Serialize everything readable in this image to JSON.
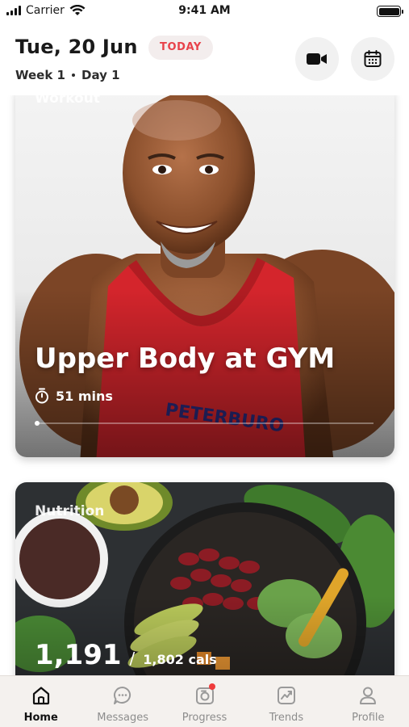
{
  "status_bar": {
    "carrier": "Carrier",
    "time": "9:41 AM"
  },
  "header": {
    "date": "Tue, 20 Jun",
    "today_badge": "TODAY",
    "week": "Week 1",
    "day": "Day 1",
    "video_icon": "video-camera-icon",
    "calendar_icon": "calendar-icon"
  },
  "workout_card": {
    "label": "Workout",
    "title": "Upper Body at GYM",
    "duration": "51 mins",
    "progress_fraction": 0.0
  },
  "nutrition_card": {
    "label": "Nutrition",
    "calories_eaten": "1,191",
    "separator": "/",
    "calories_target": "1,802 cals"
  },
  "tabbar": {
    "items": [
      {
        "label": "Home",
        "icon": "home-icon",
        "active": true
      },
      {
        "label": "Messages",
        "icon": "chat-bubble-icon",
        "active": false
      },
      {
        "label": "Progress",
        "icon": "progress-camera-icon",
        "active": false,
        "badge": true
      },
      {
        "label": "Trends",
        "icon": "trend-chart-icon",
        "active": false
      },
      {
        "label": "Profile",
        "icon": "person-icon",
        "active": false
      }
    ]
  },
  "colors": {
    "accent": "#e8424a",
    "badge_bg": "#f3eded",
    "tabbar_bg": "#f4f1ee"
  }
}
